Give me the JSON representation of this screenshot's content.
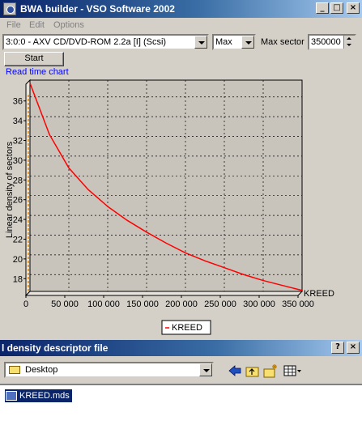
{
  "window": {
    "title": "BWA builder - VSO Software 2002"
  },
  "menu": [
    "File",
    "Edit",
    "Options"
  ],
  "controls": {
    "drive": "3:0:0 - AXV CD/DVD-ROM 2.2a [I] (Scsi)",
    "speed": "Max",
    "max_sector_label": "Max sector",
    "max_sector_value": "350000",
    "start_label": "Start",
    "chart_caption": "Read time chart"
  },
  "chart_data": {
    "type": "line",
    "title": "",
    "ylabel": "Linear density of sectors",
    "xlabel": "",
    "x_ticks": [
      "0",
      "50 000",
      "100 000",
      "150 000",
      "200 000",
      "250 000",
      "300 000",
      "350 000"
    ],
    "y_ticks": [
      "18",
      "20",
      "22",
      "24",
      "26",
      "28",
      "30",
      "32",
      "34",
      "36"
    ],
    "xlim": [
      0,
      350000
    ],
    "ylim": [
      16.3,
      37.7
    ],
    "series": [
      {
        "name": "KREED",
        "color": "#ff0000",
        "x": [
          0,
          25000,
          50000,
          75000,
          100000,
          125000,
          150000,
          175000,
          200000,
          225000,
          250000,
          275000,
          300000,
          325000,
          350000
        ],
        "y": [
          37.4,
          32.2,
          28.8,
          26.6,
          24.9,
          23.5,
          22.3,
          21.2,
          20.2,
          19.4,
          18.7,
          18.0,
          17.4,
          16.9,
          16.4
        ]
      }
    ],
    "grid": true,
    "legend": "bottom-center"
  },
  "dialog": {
    "title": "l density descriptor file",
    "help": "?",
    "location": "Desktop",
    "files": [
      "KREED.mds"
    ]
  }
}
